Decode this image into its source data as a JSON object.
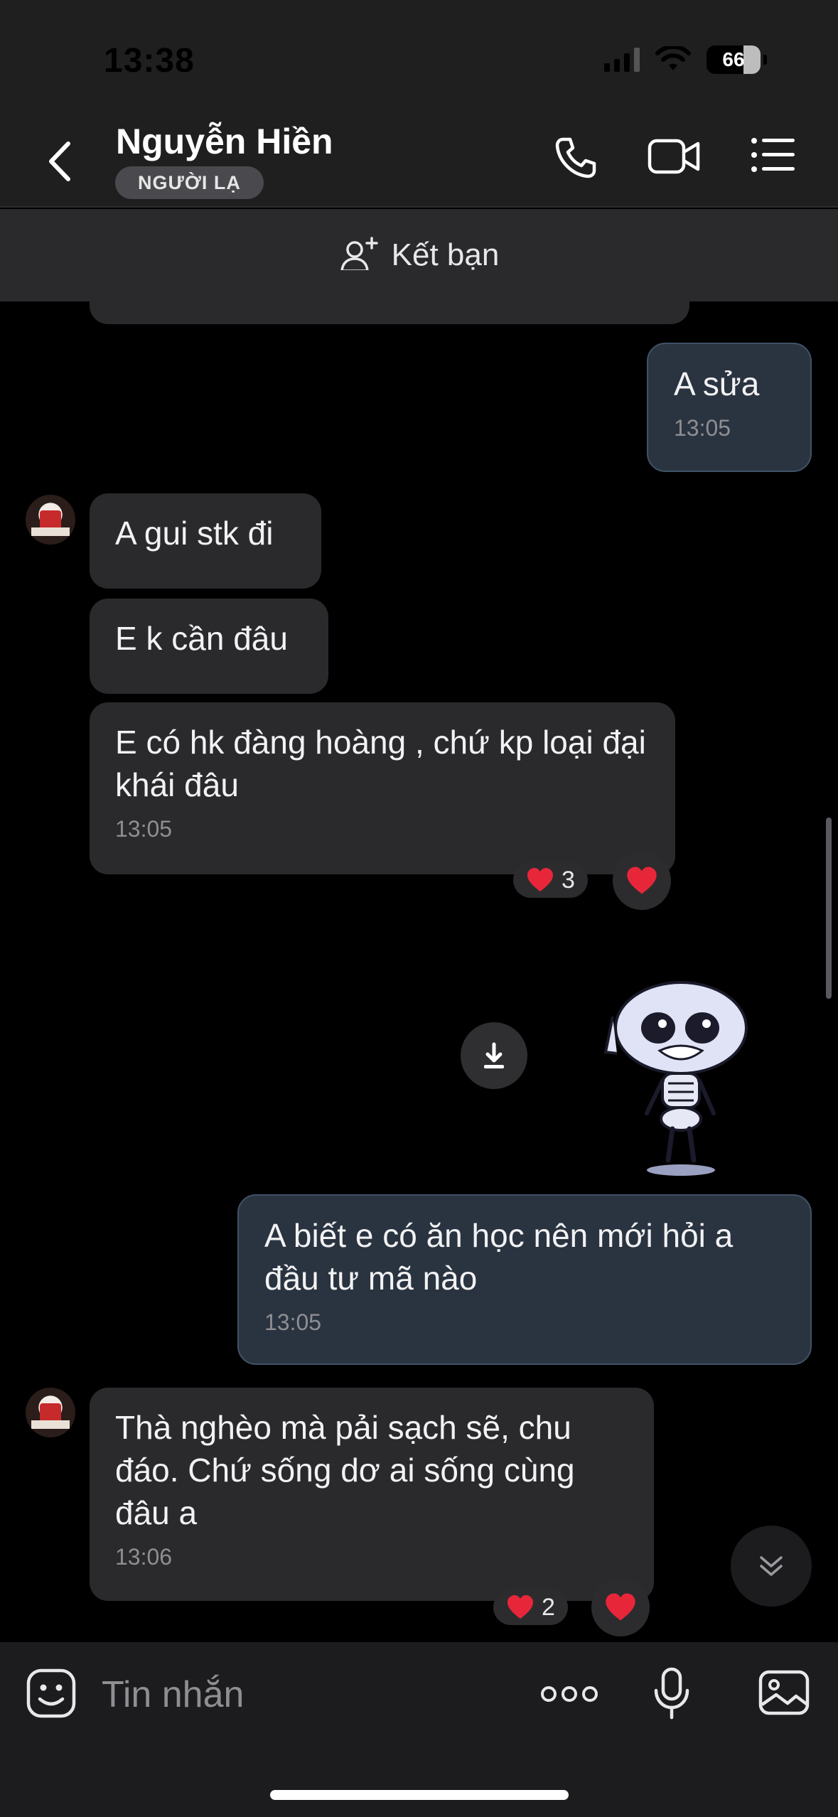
{
  "status_bar": {
    "time": "13:38",
    "battery": "66"
  },
  "header": {
    "contact_name": "Nguyễn Hiền",
    "badge": "NGƯỜI LẠ"
  },
  "friend_bar": {
    "label": "Kết bạn"
  },
  "messages": [
    {
      "direction": "out",
      "text": "A sửa",
      "time": "13:05"
    },
    {
      "direction": "in",
      "text": "A gui stk đi"
    },
    {
      "direction": "in",
      "text": "E k cần đâu"
    },
    {
      "direction": "in",
      "text": "E có hk đàng hoàng , chứ kp loại đại khái đâu",
      "time": "13:05",
      "reaction_count": "3"
    },
    {
      "direction": "out",
      "type": "sticker",
      "sticker": "skeleton-sticker"
    },
    {
      "direction": "out",
      "text": "A biết e có ăn học nên mới hỏi a đầu tư mã nào",
      "time": "13:05"
    },
    {
      "direction": "in",
      "text": "Thà nghèo mà pải sạch sẽ, chu đáo. Chứ sống dơ ai sống cùng đâu a",
      "time": "13:06",
      "reaction_count": "2"
    }
  ],
  "composer": {
    "placeholder": "Tin nhắn"
  },
  "colors": {
    "incoming_bubble": "#2a2a2c",
    "outgoing_bubble": "#2a3440",
    "heart": "#e8263a"
  },
  "icons": [
    "back-icon",
    "phone-icon",
    "video-call-icon",
    "menu-icon",
    "add-friend-icon",
    "heart-icon",
    "download-icon",
    "chevron-double-down-icon",
    "emoji-icon",
    "more-icon",
    "microphone-icon",
    "image-icon"
  ]
}
